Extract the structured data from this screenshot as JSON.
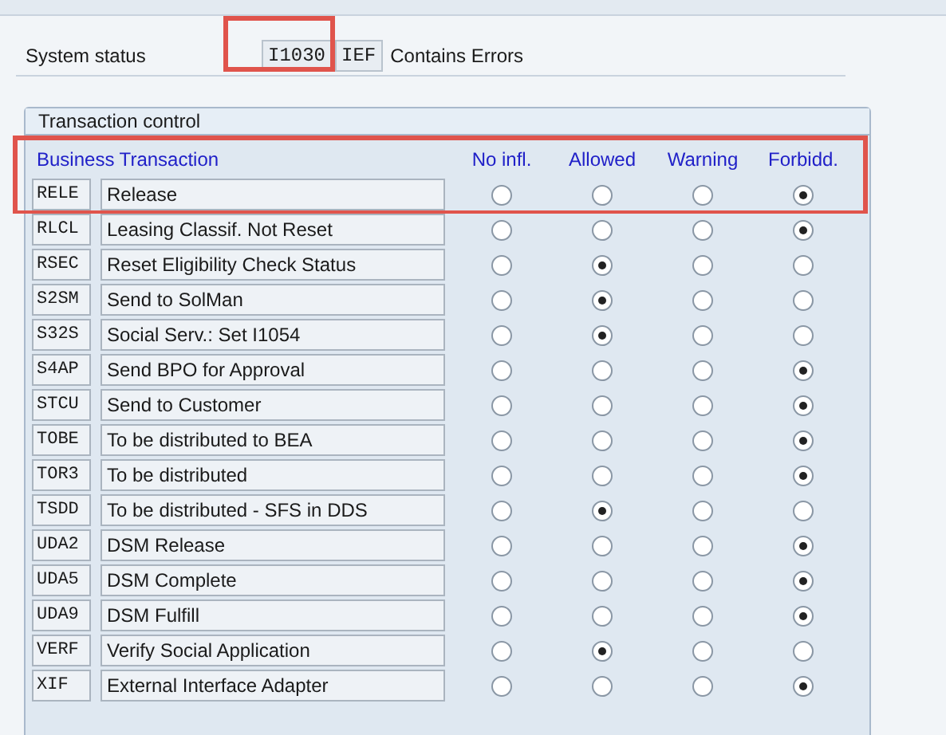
{
  "system_status": {
    "label": "System status",
    "codes": [
      "I1030",
      "IEF"
    ],
    "text": "Contains Errors",
    "code_highlighted": true
  },
  "transaction_control": {
    "title": "Transaction control",
    "header_highlighted": true,
    "columns": [
      "Business Transaction",
      "No infl.",
      "Allowed",
      "Warning",
      "Forbidd."
    ],
    "rows": [
      {
        "code": "RELE",
        "text": "Release",
        "options": [
          {
            "selected": false
          },
          {
            "selected": false
          },
          {
            "selected": false
          },
          {
            "selected": true
          }
        ]
      },
      {
        "code": "RLCL",
        "text": "Leasing Classif. Not Reset",
        "options": [
          {
            "selected": false
          },
          {
            "selected": false
          },
          {
            "selected": false
          },
          {
            "selected": true
          }
        ]
      },
      {
        "code": "RSEC",
        "text": "Reset Eligibility Check Status",
        "options": [
          {
            "selected": false
          },
          {
            "selected": true
          },
          {
            "selected": false
          },
          {
            "selected": false
          }
        ]
      },
      {
        "code": "S2SM",
        "text": "Send to SolMan",
        "options": [
          {
            "selected": false
          },
          {
            "selected": true
          },
          {
            "selected": false
          },
          {
            "selected": false
          }
        ]
      },
      {
        "code": "S32S",
        "text": "Social Serv.: Set I1054",
        "options": [
          {
            "selected": false
          },
          {
            "selected": true
          },
          {
            "selected": false
          },
          {
            "selected": false
          }
        ]
      },
      {
        "code": "S4AP",
        "text": "Send BPO for Approval",
        "options": [
          {
            "selected": false
          },
          {
            "selected": false
          },
          {
            "selected": false
          },
          {
            "selected": true
          }
        ]
      },
      {
        "code": "STCU",
        "text": "Send to Customer",
        "options": [
          {
            "selected": false
          },
          {
            "selected": false
          },
          {
            "selected": false
          },
          {
            "selected": true
          }
        ]
      },
      {
        "code": "TOBE",
        "text": "To be distributed to BEA",
        "options": [
          {
            "selected": false
          },
          {
            "selected": false
          },
          {
            "selected": false
          },
          {
            "selected": true
          }
        ]
      },
      {
        "code": "TOR3",
        "text": "To be distributed",
        "options": [
          {
            "selected": false
          },
          {
            "selected": false
          },
          {
            "selected": false
          },
          {
            "selected": true
          }
        ]
      },
      {
        "code": "TSDD",
        "text": "To be distributed - SFS in DDS",
        "options": [
          {
            "selected": false
          },
          {
            "selected": true
          },
          {
            "selected": false
          },
          {
            "selected": false
          }
        ]
      },
      {
        "code": "UDA2",
        "text": "DSM Release",
        "options": [
          {
            "selected": false
          },
          {
            "selected": false
          },
          {
            "selected": false
          },
          {
            "selected": true
          }
        ]
      },
      {
        "code": "UDA5",
        "text": "DSM Complete",
        "options": [
          {
            "selected": false
          },
          {
            "selected": false
          },
          {
            "selected": false
          },
          {
            "selected": true
          }
        ]
      },
      {
        "code": "UDA9",
        "text": "DSM Fulfill",
        "options": [
          {
            "selected": false
          },
          {
            "selected": false
          },
          {
            "selected": false
          },
          {
            "selected": true
          }
        ]
      },
      {
        "code": "VERF",
        "text": "Verify Social Application",
        "options": [
          {
            "selected": false
          },
          {
            "selected": true
          },
          {
            "selected": false
          },
          {
            "selected": false
          }
        ]
      },
      {
        "code": "XIF",
        "text": "External Interface Adapter",
        "options": [
          {
            "selected": false
          },
          {
            "selected": false
          },
          {
            "selected": false
          },
          {
            "selected": true
          }
        ]
      }
    ]
  }
}
